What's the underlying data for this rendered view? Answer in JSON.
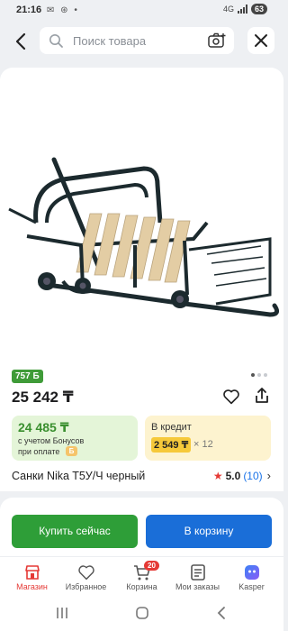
{
  "status": {
    "time": "21:16",
    "left_icons": "✉ ⊛ •",
    "network": "4G",
    "battery": "63"
  },
  "search": {
    "placeholder": "Поиск товара"
  },
  "product": {
    "points_badge": "757 Б",
    "price": "25 242 ₸",
    "bonus": {
      "value": "24 485 ₸",
      "line1": "с учетом Бонусов",
      "line2": "при оплате",
      "coin_label": "Б"
    },
    "credit": {
      "title": "В кредит",
      "amount": "2 549 ₸",
      "multiplier": "× 12"
    },
    "title": "Санки Nika T5У/Ч черный",
    "rating": {
      "score": "5.0",
      "count": "(10)"
    },
    "gallery": {
      "total": 3,
      "active": 1
    }
  },
  "actions": {
    "buy_now": "Купить сейчас",
    "add_to_cart": "В корзину"
  },
  "tabs": [
    {
      "label": "Магазин",
      "icon": "shop-icon",
      "active": true
    },
    {
      "label": "Избранное",
      "icon": "heart-icon"
    },
    {
      "label": "Корзина",
      "icon": "cart-icon",
      "badge": "20"
    },
    {
      "label": "Мои заказы",
      "icon": "orders-icon"
    },
    {
      "label": "Kasper",
      "icon": "kasper-icon"
    }
  ],
  "colors": {
    "green": "#2e9e38",
    "blue": "#1a6ed8",
    "red": "#e53935"
  }
}
